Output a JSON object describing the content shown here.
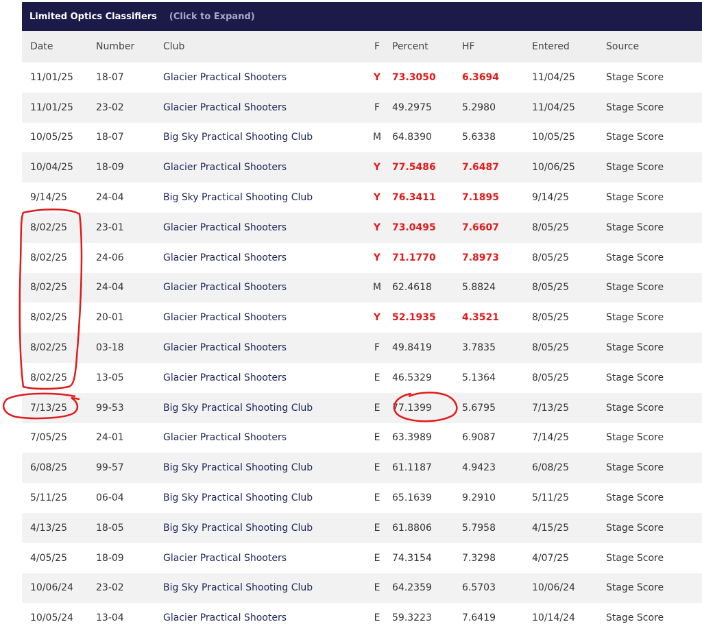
{
  "header": {
    "title": "Limited Optics Classifiers",
    "expand_label": "(Click to Expand)"
  },
  "columns": [
    "Date",
    "Number",
    "Club",
    "F",
    "Percent",
    "HF",
    "Entered",
    "Source"
  ],
  "rows": [
    {
      "date": "11/01/25",
      "number": "18-07",
      "club": "Glacier Practical Shooters",
      "flag": "Y",
      "percent": "73.3050",
      "hf": "6.3694",
      "entered": "11/04/25",
      "source": "Stage Score",
      "highlight": true
    },
    {
      "date": "11/01/25",
      "number": "23-02",
      "club": "Glacier Practical Shooters",
      "flag": "F",
      "percent": "49.2975",
      "hf": "5.2980",
      "entered": "11/04/25",
      "source": "Stage Score",
      "highlight": false
    },
    {
      "date": "10/05/25",
      "number": "18-07",
      "club": "Big Sky Practical Shooting Club",
      "flag": "M",
      "percent": "64.8390",
      "hf": "5.6338",
      "entered": "10/05/25",
      "source": "Stage Score",
      "highlight": false
    },
    {
      "date": "10/04/25",
      "number": "18-09",
      "club": "Glacier Practical Shooters",
      "flag": "Y",
      "percent": "77.5486",
      "hf": "7.6487",
      "entered": "10/06/25",
      "source": "Stage Score",
      "highlight": true
    },
    {
      "date": "9/14/25",
      "number": "24-04",
      "club": "Big Sky Practical Shooting Club",
      "flag": "Y",
      "percent": "76.3411",
      "hf": "7.1895",
      "entered": "9/14/25",
      "source": "Stage Score",
      "highlight": true
    },
    {
      "date": "8/02/25",
      "number": "23-01",
      "club": "Glacier Practical Shooters",
      "flag": "Y",
      "percent": "73.0495",
      "hf": "7.6607",
      "entered": "8/05/25",
      "source": "Stage Score",
      "highlight": true
    },
    {
      "date": "8/02/25",
      "number": "24-06",
      "club": "Glacier Practical Shooters",
      "flag": "Y",
      "percent": "71.1770",
      "hf": "7.8973",
      "entered": "8/05/25",
      "source": "Stage Score",
      "highlight": true
    },
    {
      "date": "8/02/25",
      "number": "24-04",
      "club": "Glacier Practical Shooters",
      "flag": "M",
      "percent": "62.4618",
      "hf": "5.8824",
      "entered": "8/05/25",
      "source": "Stage Score",
      "highlight": false
    },
    {
      "date": "8/02/25",
      "number": "20-01",
      "club": "Glacier Practical Shooters",
      "flag": "Y",
      "percent": "52.1935",
      "hf": "4.3521",
      "entered": "8/05/25",
      "source": "Stage Score",
      "highlight": true
    },
    {
      "date": "8/02/25",
      "number": "03-18",
      "club": "Glacier Practical Shooters",
      "flag": "F",
      "percent": "49.8419",
      "hf": "3.7835",
      "entered": "8/05/25",
      "source": "Stage Score",
      "highlight": false
    },
    {
      "date": "8/02/25",
      "number": "13-05",
      "club": "Glacier Practical Shooters",
      "flag": "E",
      "percent": "46.5329",
      "hf": "5.1364",
      "entered": "8/05/25",
      "source": "Stage Score",
      "highlight": false
    },
    {
      "date": "7/13/25",
      "number": "99-53",
      "club": "Big Sky Practical Shooting Club",
      "flag": "E",
      "percent": "77.1399",
      "hf": "5.6795",
      "entered": "7/13/25",
      "source": "Stage Score",
      "highlight": false
    },
    {
      "date": "7/05/25",
      "number": "24-01",
      "club": "Glacier Practical Shooters",
      "flag": "E",
      "percent": "63.3989",
      "hf": "6.9087",
      "entered": "7/14/25",
      "source": "Stage Score",
      "highlight": false
    },
    {
      "date": "6/08/25",
      "number": "99-57",
      "club": "Big Sky Practical Shooting Club",
      "flag": "E",
      "percent": "61.1187",
      "hf": "4.9423",
      "entered": "6/08/25",
      "source": "Stage Score",
      "highlight": false
    },
    {
      "date": "5/11/25",
      "number": "06-04",
      "club": "Big Sky Practical Shooting Club",
      "flag": "E",
      "percent": "65.1639",
      "hf": "9.2910",
      "entered": "5/11/25",
      "source": "Stage Score",
      "highlight": false
    },
    {
      "date": "4/13/25",
      "number": "18-05",
      "club": "Big Sky Practical Shooting Club",
      "flag": "E",
      "percent": "61.8806",
      "hf": "5.7958",
      "entered": "4/15/25",
      "source": "Stage Score",
      "highlight": false
    },
    {
      "date": "4/05/25",
      "number": "18-09",
      "club": "Glacier Practical Shooters",
      "flag": "E",
      "percent": "74.3154",
      "hf": "7.3298",
      "entered": "4/07/25",
      "source": "Stage Score",
      "highlight": false
    },
    {
      "date": "10/06/24",
      "number": "23-02",
      "club": "Big Sky Practical Shooting Club",
      "flag": "E",
      "percent": "64.2359",
      "hf": "6.5703",
      "entered": "10/06/24",
      "source": "Stage Score",
      "highlight": false
    },
    {
      "date": "10/05/24",
      "number": "13-04",
      "club": "Glacier Practical Shooters",
      "flag": "E",
      "percent": "59.3223",
      "hf": "7.6419",
      "entered": "10/14/24",
      "source": "Stage Score",
      "highlight": false
    }
  ],
  "colors": {
    "header_bg": "#1b1a48",
    "highlight": "#e01b1b",
    "annotation": "#e01b1b"
  }
}
